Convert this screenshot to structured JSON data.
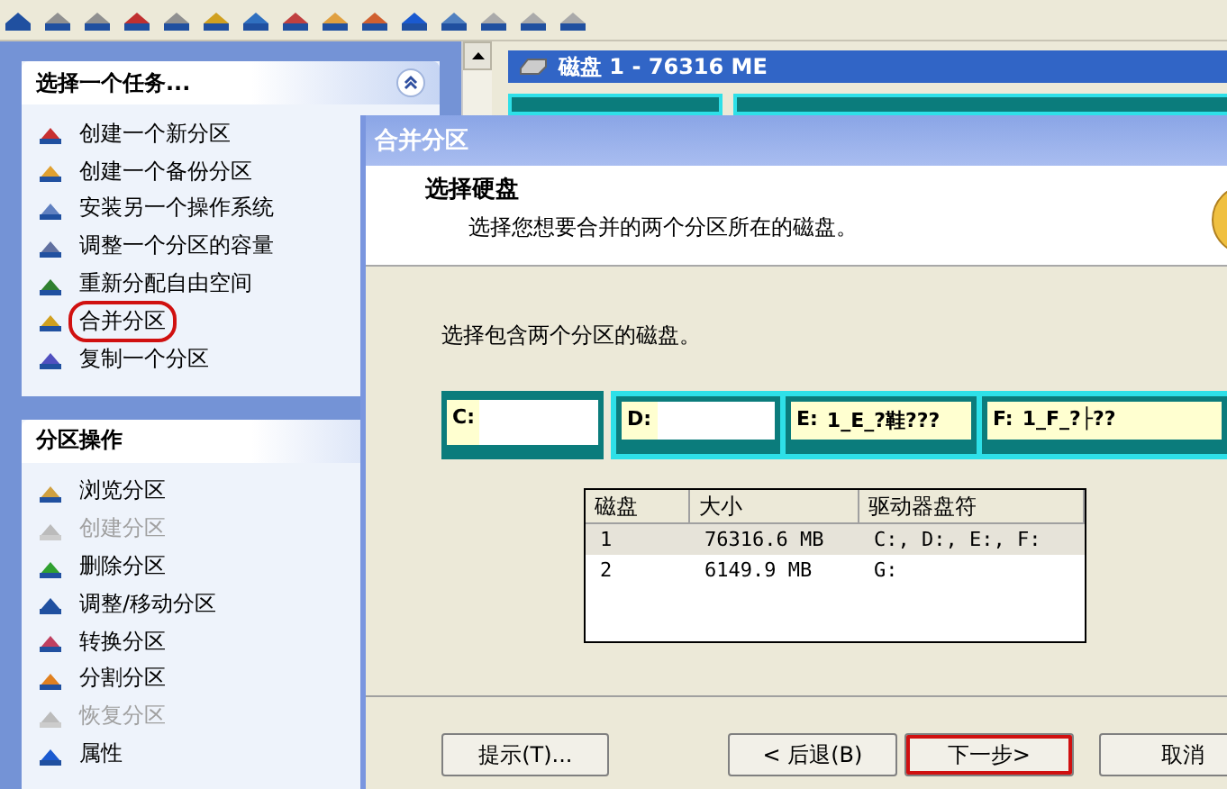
{
  "sidebar": {
    "sections": [
      {
        "title": "选择一个任务...",
        "collapsed": false,
        "items": [
          {
            "label": "创建一个新分区",
            "disabled": false,
            "highlighted": false
          },
          {
            "label": "创建一个备份分区",
            "disabled": false,
            "highlighted": false
          },
          {
            "label": "安装另一个操作系统",
            "disabled": false,
            "highlighted": false
          },
          {
            "label": "调整一个分区的容量",
            "disabled": false,
            "highlighted": false
          },
          {
            "label": "重新分配自由空间",
            "disabled": false,
            "highlighted": false
          },
          {
            "label": "合并分区",
            "disabled": false,
            "highlighted": true
          },
          {
            "label": "复制一个分区",
            "disabled": false,
            "highlighted": false
          }
        ]
      },
      {
        "title": "分区操作",
        "items": [
          {
            "label": "浏览分区",
            "disabled": false,
            "highlighted": false
          },
          {
            "label": "创建分区",
            "disabled": true,
            "highlighted": false
          },
          {
            "label": "删除分区",
            "disabled": false,
            "highlighted": false
          },
          {
            "label": "调整/移动分区",
            "disabled": false,
            "highlighted": false
          },
          {
            "label": "转换分区",
            "disabled": false,
            "highlighted": false
          },
          {
            "label": "分割分区",
            "disabled": false,
            "highlighted": false
          },
          {
            "label": "恢复分区",
            "disabled": true,
            "highlighted": false
          },
          {
            "label": "属性",
            "disabled": false,
            "highlighted": false
          }
        ]
      }
    ]
  },
  "disk_header": "磁盘 1 - 76316 ME",
  "dialog": {
    "title": "合并分区",
    "heading": "选择硬盘",
    "subtitle": "选择您想要合并的两个分区所在的磁盘。",
    "instruction": "选择包含两个分区的磁盘。",
    "disk_map": [
      {
        "kind": "primary",
        "letter": "C:"
      },
      {
        "kind": "logical",
        "letter": "D:"
      },
      {
        "kind": "logical",
        "letter": "E:",
        "label": "1_E_?鞋???"
      },
      {
        "kind": "logical",
        "letter": "F:",
        "label": "1_F_?├??"
      }
    ],
    "table": {
      "columns": [
        "磁盘",
        "大小",
        "驱动器盘符"
      ],
      "rows": [
        {
          "cells": [
            "1",
            "76316.6 MB",
            "C:, D:, E:, F:"
          ],
          "selected": true
        },
        {
          "cells": [
            "2",
            "6149.9 MB",
            "G:"
          ],
          "selected": false
        }
      ]
    },
    "buttons": [
      {
        "label": "提示(T)...",
        "highlighted": false
      },
      {
        "label": "< 后退(B)",
        "highlighted": false
      },
      {
        "label": "下一步>",
        "highlighted": true
      },
      {
        "label": "取消",
        "highlighted": false
      }
    ]
  }
}
